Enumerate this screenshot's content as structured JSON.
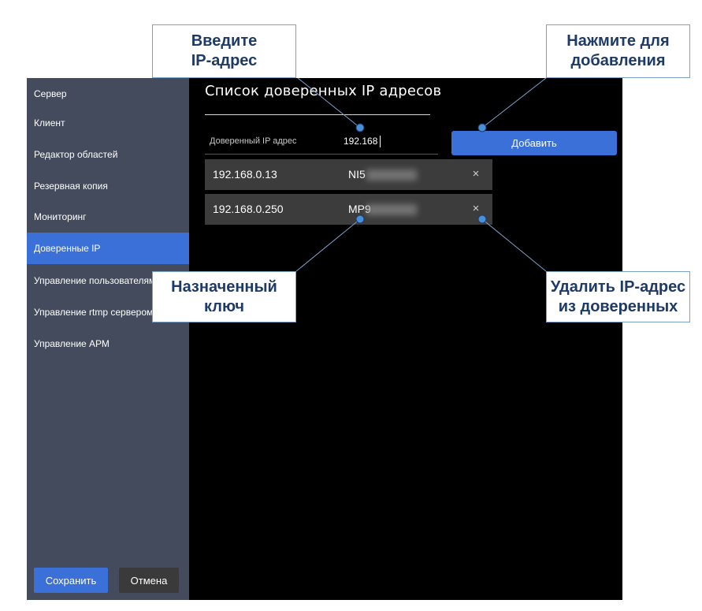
{
  "sidebar": {
    "items": [
      {
        "label": "Сервер",
        "active": false
      },
      {
        "label": "Клиент",
        "active": false
      },
      {
        "label": "Редактор областей",
        "active": false
      },
      {
        "label": "Резервная копия",
        "active": false
      },
      {
        "label": "Мониторинг",
        "active": false
      },
      {
        "label": "Доверенные IP",
        "active": true
      },
      {
        "label": "Управление пользователями",
        "active": false
      },
      {
        "label": "Управление rtmp сервером",
        "active": false
      },
      {
        "label": "Управление АРМ",
        "active": false
      }
    ],
    "save_label": "Сохранить",
    "cancel_label": "Отмена"
  },
  "main": {
    "title": "Список доверенных IP адресов",
    "ip_field_label": "Доверенный IP адрес",
    "ip_field_value": "192.168",
    "add_label": "Добавить",
    "rows": [
      {
        "ip": "192.168.0.13",
        "key": "NI5",
        "remove": "×"
      },
      {
        "ip": "192.168.0.250",
        "key": "MP9",
        "remove": "×"
      }
    ]
  },
  "callouts": {
    "enter_ip": "Введите\nIP-адрес",
    "press_add": "Нажмите для\nдобавления",
    "assigned_key": "Назначенный\nключ",
    "remove_ip": "Удалить IP-адрес\nиз доверенных"
  },
  "colors": {
    "accent": "#3b70d8",
    "sidebar_bg": "#444b5d",
    "callout_text": "#1e3a66",
    "callout_border": "#7da2c8"
  }
}
